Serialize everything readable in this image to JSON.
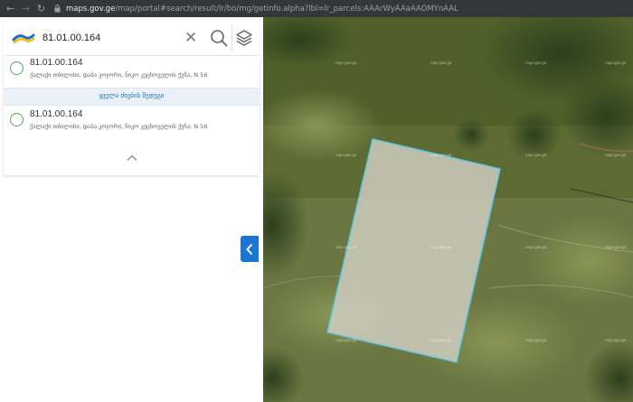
{
  "browser": {
    "url_host": "maps.gov.ge",
    "url_path": "/map/portal#search/result/lr/bo/mg/getinfo.alpha?lbl=lr_parcels:AAArWyAAaAAOMYnAAL"
  },
  "search": {
    "query": "81.01.00.164"
  },
  "results": [
    {
      "title": "81.01.00.164",
      "address": "ქალაქი თბილისი, დაბა კოჯორი, ნიკო კეცხოველის ქუჩა, N 56"
    },
    {
      "title": "81.01.00.164",
      "address": "ქალაქი თბილისი, დაბა კოჯორი, ნიკო კეცხოველის ქუჩა, N 56"
    }
  ],
  "more_label": "ყველა ძიების შედეგი",
  "map": {
    "watermark_label": "napr.gov.ge",
    "parcel_fill": "#d2d1c4",
    "parcel_stroke": "#5ec7e3",
    "accent": "#1976d2"
  },
  "icons": [
    "back-icon",
    "forward-icon",
    "reload-icon",
    "lock-icon",
    "logo-icon",
    "clear-icon",
    "search-icon",
    "layers-icon",
    "chevron-up-icon",
    "chevron-left-icon"
  ]
}
